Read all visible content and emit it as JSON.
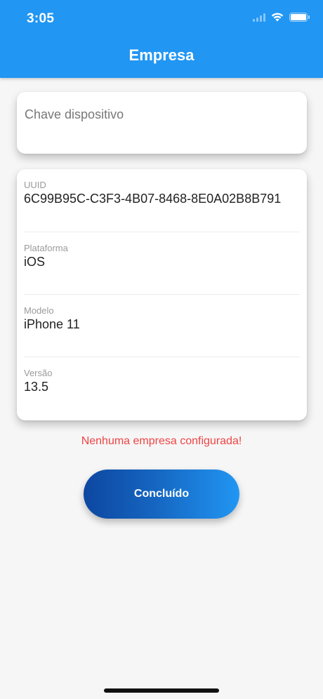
{
  "status_bar": {
    "time": "3:05",
    "icons": [
      "cellular-signal-icon",
      "wifi-icon",
      "battery-icon"
    ]
  },
  "header": {
    "title": "Empresa",
    "background_color": "#2196f3"
  },
  "device_key": {
    "placeholder": "Chave dispositivo",
    "value": ""
  },
  "device_info": [
    {
      "label": "UUID",
      "value": "6C99B95C-C3F3-4B07-8468-8E0A02B8B791"
    },
    {
      "label": "Plataforma",
      "value": "iOS"
    },
    {
      "label": "Modelo",
      "value": "iPhone 11"
    },
    {
      "label": "Versão",
      "value": "13.5"
    }
  ],
  "error_message": "Nenhuma empresa configurada!",
  "error_color": "#ef4444",
  "done_button": {
    "label": "Concluído",
    "gradient": [
      "#0d47a1",
      "#2196f3"
    ]
  }
}
